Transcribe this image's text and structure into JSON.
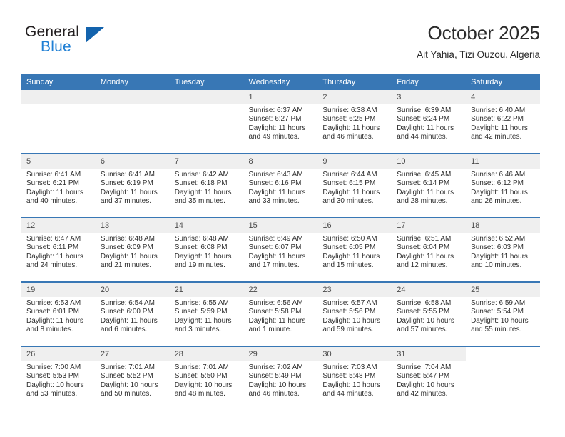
{
  "brand": {
    "line1": "General",
    "line2": "Blue",
    "accent_color": "#1363ad",
    "blue_text_color": "#1f7fd4"
  },
  "header": {
    "title": "October 2025",
    "subtitle": "Ait Yahia, Tizi Ouzou, Algeria"
  },
  "calendar": {
    "header_bg": "#3877b5",
    "datecell_bg": "#efefef",
    "weekdays": [
      "Sunday",
      "Monday",
      "Tuesday",
      "Wednesday",
      "Thursday",
      "Friday",
      "Saturday"
    ],
    "weeks": [
      [
        {
          "day": "",
          "sunrise": "",
          "sunset": "",
          "daylight1": "",
          "daylight2": ""
        },
        {
          "day": "",
          "sunrise": "",
          "sunset": "",
          "daylight1": "",
          "daylight2": ""
        },
        {
          "day": "",
          "sunrise": "",
          "sunset": "",
          "daylight1": "",
          "daylight2": ""
        },
        {
          "day": "1",
          "sunrise": "Sunrise: 6:37 AM",
          "sunset": "Sunset: 6:27 PM",
          "daylight1": "Daylight: 11 hours",
          "daylight2": "and 49 minutes."
        },
        {
          "day": "2",
          "sunrise": "Sunrise: 6:38 AM",
          "sunset": "Sunset: 6:25 PM",
          "daylight1": "Daylight: 11 hours",
          "daylight2": "and 46 minutes."
        },
        {
          "day": "3",
          "sunrise": "Sunrise: 6:39 AM",
          "sunset": "Sunset: 6:24 PM",
          "daylight1": "Daylight: 11 hours",
          "daylight2": "and 44 minutes."
        },
        {
          "day": "4",
          "sunrise": "Sunrise: 6:40 AM",
          "sunset": "Sunset: 6:22 PM",
          "daylight1": "Daylight: 11 hours",
          "daylight2": "and 42 minutes."
        }
      ],
      [
        {
          "day": "5",
          "sunrise": "Sunrise: 6:41 AM",
          "sunset": "Sunset: 6:21 PM",
          "daylight1": "Daylight: 11 hours",
          "daylight2": "and 40 minutes."
        },
        {
          "day": "6",
          "sunrise": "Sunrise: 6:41 AM",
          "sunset": "Sunset: 6:19 PM",
          "daylight1": "Daylight: 11 hours",
          "daylight2": "and 37 minutes."
        },
        {
          "day": "7",
          "sunrise": "Sunrise: 6:42 AM",
          "sunset": "Sunset: 6:18 PM",
          "daylight1": "Daylight: 11 hours",
          "daylight2": "and 35 minutes."
        },
        {
          "day": "8",
          "sunrise": "Sunrise: 6:43 AM",
          "sunset": "Sunset: 6:16 PM",
          "daylight1": "Daylight: 11 hours",
          "daylight2": "and 33 minutes."
        },
        {
          "day": "9",
          "sunrise": "Sunrise: 6:44 AM",
          "sunset": "Sunset: 6:15 PM",
          "daylight1": "Daylight: 11 hours",
          "daylight2": "and 30 minutes."
        },
        {
          "day": "10",
          "sunrise": "Sunrise: 6:45 AM",
          "sunset": "Sunset: 6:14 PM",
          "daylight1": "Daylight: 11 hours",
          "daylight2": "and 28 minutes."
        },
        {
          "day": "11",
          "sunrise": "Sunrise: 6:46 AM",
          "sunset": "Sunset: 6:12 PM",
          "daylight1": "Daylight: 11 hours",
          "daylight2": "and 26 minutes."
        }
      ],
      [
        {
          "day": "12",
          "sunrise": "Sunrise: 6:47 AM",
          "sunset": "Sunset: 6:11 PM",
          "daylight1": "Daylight: 11 hours",
          "daylight2": "and 24 minutes."
        },
        {
          "day": "13",
          "sunrise": "Sunrise: 6:48 AM",
          "sunset": "Sunset: 6:09 PM",
          "daylight1": "Daylight: 11 hours",
          "daylight2": "and 21 minutes."
        },
        {
          "day": "14",
          "sunrise": "Sunrise: 6:48 AM",
          "sunset": "Sunset: 6:08 PM",
          "daylight1": "Daylight: 11 hours",
          "daylight2": "and 19 minutes."
        },
        {
          "day": "15",
          "sunrise": "Sunrise: 6:49 AM",
          "sunset": "Sunset: 6:07 PM",
          "daylight1": "Daylight: 11 hours",
          "daylight2": "and 17 minutes."
        },
        {
          "day": "16",
          "sunrise": "Sunrise: 6:50 AM",
          "sunset": "Sunset: 6:05 PM",
          "daylight1": "Daylight: 11 hours",
          "daylight2": "and 15 minutes."
        },
        {
          "day": "17",
          "sunrise": "Sunrise: 6:51 AM",
          "sunset": "Sunset: 6:04 PM",
          "daylight1": "Daylight: 11 hours",
          "daylight2": "and 12 minutes."
        },
        {
          "day": "18",
          "sunrise": "Sunrise: 6:52 AM",
          "sunset": "Sunset: 6:03 PM",
          "daylight1": "Daylight: 11 hours",
          "daylight2": "and 10 minutes."
        }
      ],
      [
        {
          "day": "19",
          "sunrise": "Sunrise: 6:53 AM",
          "sunset": "Sunset: 6:01 PM",
          "daylight1": "Daylight: 11 hours",
          "daylight2": "and 8 minutes."
        },
        {
          "day": "20",
          "sunrise": "Sunrise: 6:54 AM",
          "sunset": "Sunset: 6:00 PM",
          "daylight1": "Daylight: 11 hours",
          "daylight2": "and 6 minutes."
        },
        {
          "day": "21",
          "sunrise": "Sunrise: 6:55 AM",
          "sunset": "Sunset: 5:59 PM",
          "daylight1": "Daylight: 11 hours",
          "daylight2": "and 3 minutes."
        },
        {
          "day": "22",
          "sunrise": "Sunrise: 6:56 AM",
          "sunset": "Sunset: 5:58 PM",
          "daylight1": "Daylight: 11 hours",
          "daylight2": "and 1 minute."
        },
        {
          "day": "23",
          "sunrise": "Sunrise: 6:57 AM",
          "sunset": "Sunset: 5:56 PM",
          "daylight1": "Daylight: 10 hours",
          "daylight2": "and 59 minutes."
        },
        {
          "day": "24",
          "sunrise": "Sunrise: 6:58 AM",
          "sunset": "Sunset: 5:55 PM",
          "daylight1": "Daylight: 10 hours",
          "daylight2": "and 57 minutes."
        },
        {
          "day": "25",
          "sunrise": "Sunrise: 6:59 AM",
          "sunset": "Sunset: 5:54 PM",
          "daylight1": "Daylight: 10 hours",
          "daylight2": "and 55 minutes."
        }
      ],
      [
        {
          "day": "26",
          "sunrise": "Sunrise: 7:00 AM",
          "sunset": "Sunset: 5:53 PM",
          "daylight1": "Daylight: 10 hours",
          "daylight2": "and 53 minutes."
        },
        {
          "day": "27",
          "sunrise": "Sunrise: 7:01 AM",
          "sunset": "Sunset: 5:52 PM",
          "daylight1": "Daylight: 10 hours",
          "daylight2": "and 50 minutes."
        },
        {
          "day": "28",
          "sunrise": "Sunrise: 7:01 AM",
          "sunset": "Sunset: 5:50 PM",
          "daylight1": "Daylight: 10 hours",
          "daylight2": "and 48 minutes."
        },
        {
          "day": "29",
          "sunrise": "Sunrise: 7:02 AM",
          "sunset": "Sunset: 5:49 PM",
          "daylight1": "Daylight: 10 hours",
          "daylight2": "and 46 minutes."
        },
        {
          "day": "30",
          "sunrise": "Sunrise: 7:03 AM",
          "sunset": "Sunset: 5:48 PM",
          "daylight1": "Daylight: 10 hours",
          "daylight2": "and 44 minutes."
        },
        {
          "day": "31",
          "sunrise": "Sunrise: 7:04 AM",
          "sunset": "Sunset: 5:47 PM",
          "daylight1": "Daylight: 10 hours",
          "daylight2": "and 42 minutes."
        },
        {
          "day": "",
          "sunrise": "",
          "sunset": "",
          "daylight1": "",
          "daylight2": ""
        }
      ]
    ]
  }
}
